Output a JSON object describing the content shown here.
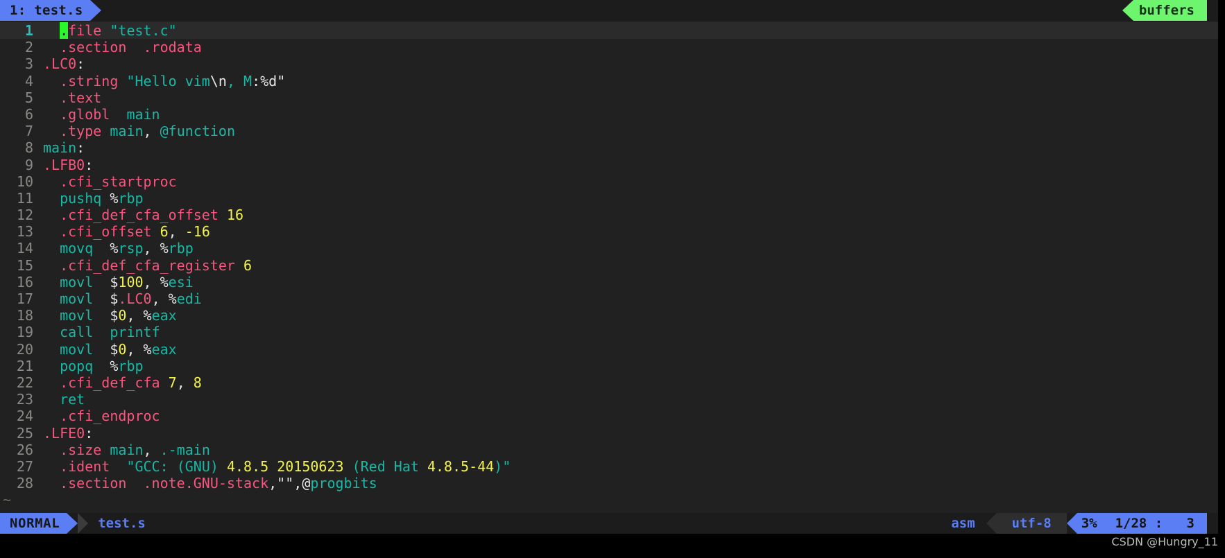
{
  "tabline": {
    "tab_label": "1: test.s",
    "buffers_label": "buffers",
    "tab_bg": "#5b7ef5",
    "buffers_bg": "#6ef56e"
  },
  "editor": {
    "cursor_char": ".",
    "cursor_color": "#2bf52b",
    "current_line": 1,
    "total_lines": 28,
    "tilde_rows": 2,
    "lines": [
      {
        "num": "1",
        "tokens": [
          {
            "t": "  ",
            "c": "p"
          },
          {
            "t": ".",
            "c": "cursor"
          },
          {
            "t": "file",
            "c": "d"
          },
          {
            "t": " ",
            "c": "p"
          },
          {
            "t": "\"test.c\"",
            "c": "s"
          }
        ]
      },
      {
        "num": "2",
        "tokens": [
          {
            "t": "  ",
            "c": "p"
          },
          {
            "t": ".section",
            "c": "d"
          },
          {
            "t": "  ",
            "c": "p"
          },
          {
            "t": ".rodata",
            "c": "d"
          }
        ]
      },
      {
        "num": "3",
        "tokens": [
          {
            "t": ".LC0",
            "c": "d"
          },
          {
            "t": ":",
            "c": "p"
          }
        ]
      },
      {
        "num": "4",
        "tokens": [
          {
            "t": "  ",
            "c": "p"
          },
          {
            "t": ".string",
            "c": "d"
          },
          {
            "t": " ",
            "c": "p"
          },
          {
            "t": "\"Hello vim",
            "c": "s"
          },
          {
            "t": "\\n",
            "c": "p"
          },
          {
            "t": ", M",
            "c": "s"
          },
          {
            "t": ":%d\"",
            "c": "p"
          }
        ]
      },
      {
        "num": "5",
        "tokens": [
          {
            "t": "  ",
            "c": "p"
          },
          {
            "t": ".text",
            "c": "d"
          }
        ]
      },
      {
        "num": "6",
        "tokens": [
          {
            "t": "  ",
            "c": "p"
          },
          {
            "t": ".globl",
            "c": "d"
          },
          {
            "t": "  ",
            "c": "p"
          },
          {
            "t": "main",
            "c": "i"
          }
        ]
      },
      {
        "num": "7",
        "tokens": [
          {
            "t": "  ",
            "c": "p"
          },
          {
            "t": ".type",
            "c": "d"
          },
          {
            "t": " ",
            "c": "p"
          },
          {
            "t": "main",
            "c": "i"
          },
          {
            "t": ", ",
            "c": "p"
          },
          {
            "t": "@function",
            "c": "i"
          }
        ]
      },
      {
        "num": "8",
        "tokens": [
          {
            "t": "main",
            "c": "i"
          },
          {
            "t": ":",
            "c": "p"
          }
        ]
      },
      {
        "num": "9",
        "tokens": [
          {
            "t": ".LFB0",
            "c": "d"
          },
          {
            "t": ":",
            "c": "p"
          }
        ]
      },
      {
        "num": "10",
        "tokens": [
          {
            "t": "  ",
            "c": "p"
          },
          {
            "t": ".cfi_startproc",
            "c": "d"
          }
        ]
      },
      {
        "num": "11",
        "tokens": [
          {
            "t": "  ",
            "c": "p"
          },
          {
            "t": "pushq",
            "c": "i"
          },
          {
            "t": " ",
            "c": "p"
          },
          {
            "t": "%",
            "c": "p"
          },
          {
            "t": "rbp",
            "c": "i"
          }
        ]
      },
      {
        "num": "12",
        "tokens": [
          {
            "t": "  ",
            "c": "p"
          },
          {
            "t": ".cfi_def_cfa_offset",
            "c": "d"
          },
          {
            "t": " ",
            "c": "p"
          },
          {
            "t": "16",
            "c": "n"
          }
        ]
      },
      {
        "num": "13",
        "tokens": [
          {
            "t": "  ",
            "c": "p"
          },
          {
            "t": ".cfi_offset",
            "c": "d"
          },
          {
            "t": " ",
            "c": "p"
          },
          {
            "t": "6",
            "c": "n"
          },
          {
            "t": ", ",
            "c": "p"
          },
          {
            "t": "-16",
            "c": "n"
          }
        ]
      },
      {
        "num": "14",
        "tokens": [
          {
            "t": "  ",
            "c": "p"
          },
          {
            "t": "movq",
            "c": "i"
          },
          {
            "t": "  ",
            "c": "p"
          },
          {
            "t": "%",
            "c": "p"
          },
          {
            "t": "rsp",
            "c": "i"
          },
          {
            "t": ", ",
            "c": "p"
          },
          {
            "t": "%",
            "c": "p"
          },
          {
            "t": "rbp",
            "c": "i"
          }
        ]
      },
      {
        "num": "15",
        "tokens": [
          {
            "t": "  ",
            "c": "p"
          },
          {
            "t": ".cfi_def_cfa_register",
            "c": "d"
          },
          {
            "t": " ",
            "c": "p"
          },
          {
            "t": "6",
            "c": "n"
          }
        ]
      },
      {
        "num": "16",
        "tokens": [
          {
            "t": "  ",
            "c": "p"
          },
          {
            "t": "movl",
            "c": "i"
          },
          {
            "t": "  ",
            "c": "p"
          },
          {
            "t": "$",
            "c": "p"
          },
          {
            "t": "100",
            "c": "n"
          },
          {
            "t": ", ",
            "c": "p"
          },
          {
            "t": "%",
            "c": "p"
          },
          {
            "t": "esi",
            "c": "i"
          }
        ]
      },
      {
        "num": "17",
        "tokens": [
          {
            "t": "  ",
            "c": "p"
          },
          {
            "t": "movl",
            "c": "i"
          },
          {
            "t": "  ",
            "c": "p"
          },
          {
            "t": "$",
            "c": "p"
          },
          {
            "t": ".LC0",
            "c": "d"
          },
          {
            "t": ", ",
            "c": "p"
          },
          {
            "t": "%",
            "c": "p"
          },
          {
            "t": "edi",
            "c": "i"
          }
        ]
      },
      {
        "num": "18",
        "tokens": [
          {
            "t": "  ",
            "c": "p"
          },
          {
            "t": "movl",
            "c": "i"
          },
          {
            "t": "  ",
            "c": "p"
          },
          {
            "t": "$",
            "c": "p"
          },
          {
            "t": "0",
            "c": "n"
          },
          {
            "t": ", ",
            "c": "p"
          },
          {
            "t": "%",
            "c": "p"
          },
          {
            "t": "eax",
            "c": "i"
          }
        ]
      },
      {
        "num": "19",
        "tokens": [
          {
            "t": "  ",
            "c": "p"
          },
          {
            "t": "call",
            "c": "i"
          },
          {
            "t": "  ",
            "c": "p"
          },
          {
            "t": "printf",
            "c": "i"
          }
        ]
      },
      {
        "num": "20",
        "tokens": [
          {
            "t": "  ",
            "c": "p"
          },
          {
            "t": "movl",
            "c": "i"
          },
          {
            "t": "  ",
            "c": "p"
          },
          {
            "t": "$",
            "c": "p"
          },
          {
            "t": "0",
            "c": "n"
          },
          {
            "t": ", ",
            "c": "p"
          },
          {
            "t": "%",
            "c": "p"
          },
          {
            "t": "eax",
            "c": "i"
          }
        ]
      },
      {
        "num": "21",
        "tokens": [
          {
            "t": "  ",
            "c": "p"
          },
          {
            "t": "popq",
            "c": "i"
          },
          {
            "t": "  ",
            "c": "p"
          },
          {
            "t": "%",
            "c": "p"
          },
          {
            "t": "rbp",
            "c": "i"
          }
        ]
      },
      {
        "num": "22",
        "tokens": [
          {
            "t": "  ",
            "c": "p"
          },
          {
            "t": ".cfi_def_cfa",
            "c": "d"
          },
          {
            "t": " ",
            "c": "p"
          },
          {
            "t": "7",
            "c": "n"
          },
          {
            "t": ", ",
            "c": "p"
          },
          {
            "t": "8",
            "c": "n"
          }
        ]
      },
      {
        "num": "23",
        "tokens": [
          {
            "t": "  ",
            "c": "p"
          },
          {
            "t": "ret",
            "c": "i"
          }
        ]
      },
      {
        "num": "24",
        "tokens": [
          {
            "t": "  ",
            "c": "p"
          },
          {
            "t": ".cfi_endproc",
            "c": "d"
          }
        ]
      },
      {
        "num": "25",
        "tokens": [
          {
            "t": ".LFE0",
            "c": "d"
          },
          {
            "t": ":",
            "c": "p"
          }
        ]
      },
      {
        "num": "26",
        "tokens": [
          {
            "t": "  ",
            "c": "p"
          },
          {
            "t": ".size",
            "c": "d"
          },
          {
            "t": " ",
            "c": "p"
          },
          {
            "t": "main",
            "c": "i"
          },
          {
            "t": ", ",
            "c": "p"
          },
          {
            "t": ".-main",
            "c": "i"
          }
        ]
      },
      {
        "num": "27",
        "tokens": [
          {
            "t": "  ",
            "c": "p"
          },
          {
            "t": ".ident",
            "c": "d"
          },
          {
            "t": "  ",
            "c": "p"
          },
          {
            "t": "\"GCC: ",
            "c": "s"
          },
          {
            "t": "(",
            "c": "s"
          },
          {
            "t": "GNU",
            "c": "i"
          },
          {
            "t": ") ",
            "c": "s"
          },
          {
            "t": "4.8.5 20150623",
            "c": "n"
          },
          {
            "t": " ",
            "c": "p"
          },
          {
            "t": "(Red Hat",
            "c": "s"
          },
          {
            "t": " ",
            "c": "p"
          },
          {
            "t": "4.8.5-44",
            "c": "n"
          },
          {
            "t": ")\"",
            "c": "s"
          }
        ]
      },
      {
        "num": "28",
        "tokens": [
          {
            "t": "  ",
            "c": "p"
          },
          {
            "t": ".section",
            "c": "d"
          },
          {
            "t": "  ",
            "c": "p"
          },
          {
            "t": ".note.GNU-stack",
            "c": "d"
          },
          {
            "t": ",\"\",",
            "c": "p"
          },
          {
            "t": "@",
            "c": "p"
          },
          {
            "t": "progbits",
            "c": "i"
          }
        ]
      }
    ]
  },
  "statusline": {
    "mode": "NORMAL",
    "filename": "test.s",
    "filetype": "asm",
    "encoding": "utf-8",
    "percent": "3%",
    "position": "1/28 :   3",
    "mode_bg": "#5b7ef5",
    "accent": "#5b7ef5"
  },
  "watermark": {
    "text": "CSDN @Hungry_11"
  }
}
